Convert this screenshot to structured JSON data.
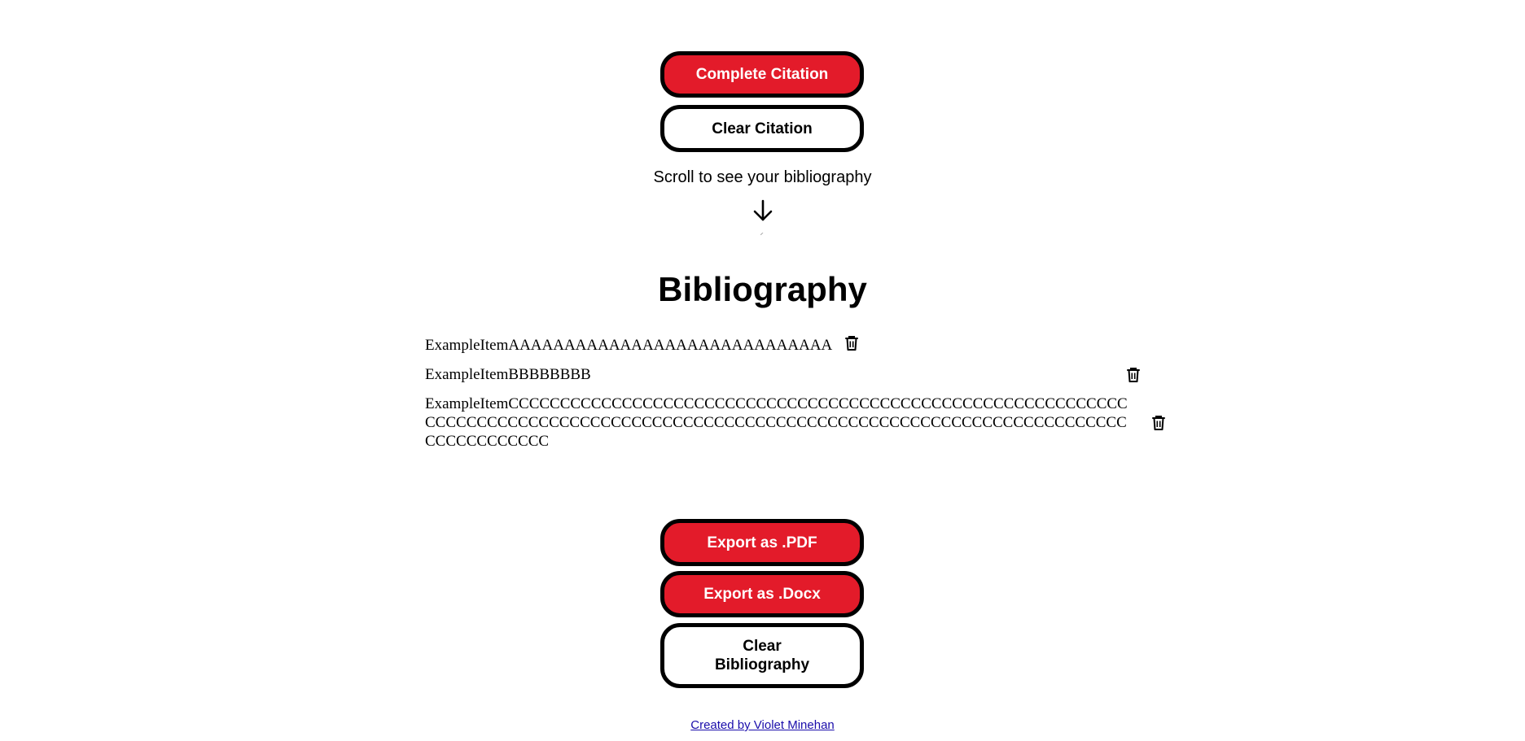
{
  "citation_actions": {
    "complete_label": "Complete Citation",
    "clear_label": "Clear Citation"
  },
  "scroll_hint": "Scroll to see your bibliography",
  "bibliography": {
    "title": "Bibliography",
    "items": [
      {
        "text": "ExampleItemAAAAAAAAAAAAAAAAAAAAAAAAAAAAA"
      },
      {
        "text": "ExampleItemBBBBBBBB"
      },
      {
        "text": "ExampleItemCCCCCCCCCCCCCCCCCCCCCCCCCCCCCCCCCCCCCCCCCCCCCCCCCCCCCCCCCCCCCCCCCCCCCCCCCCCCCCCCCCCCCCCCCCCCCCCCCCCCCCCCCCCCCCCCCCCCCCCCCCCCCCCCCCCCCCCCCCCC"
      }
    ]
  },
  "export_actions": {
    "pdf_label": "Export as .PDF",
    "docx_label": "Export as .Docx",
    "clear_label": "Clear Bibliography"
  },
  "footer": {
    "credit": "Created by Violet Minehan"
  },
  "colors": {
    "accent_red": "#e31b2a",
    "border": "#000000",
    "link": "#1a0dab"
  },
  "icons": {
    "scroll": "arrow-down-icon",
    "delete": "trash-icon"
  }
}
